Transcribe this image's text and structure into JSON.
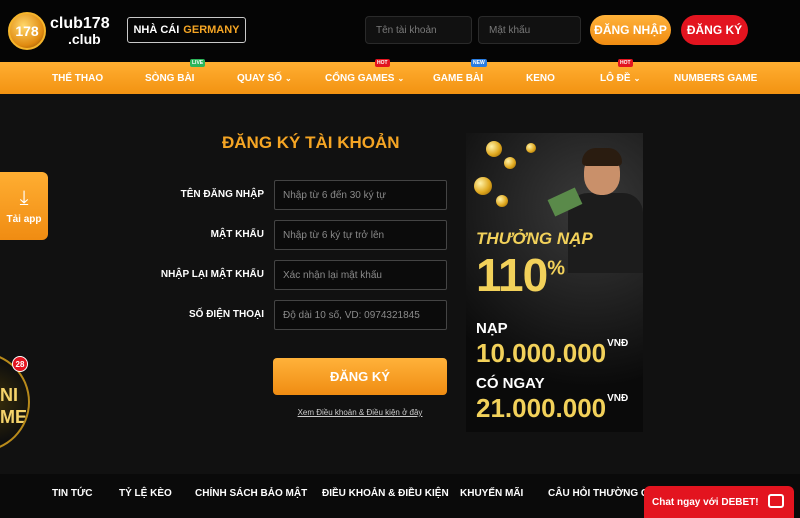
{
  "header": {
    "logo": {
      "line1": "club178",
      "line2": ".club",
      "mark": "178"
    },
    "brand_prefix": "NHÀ CÁI",
    "brand_name": "GERMANY",
    "username_placeholder": "Tên tài khoản",
    "password_placeholder": "Mật khẩu",
    "login_label": "ĐĂNG NHẬP",
    "register_label": "ĐĂNG KÝ"
  },
  "nav": {
    "items": [
      {
        "label": "THỂ THAO"
      },
      {
        "label": "SÒNG BÀI",
        "tag": "LIVE"
      },
      {
        "label": "QUAY SỐ",
        "chevron": "⌄"
      },
      {
        "label": "CỔNG GAMES",
        "tag": "HOT",
        "chevron": "⌄"
      },
      {
        "label": "GAME BÀI",
        "tag": "NEW"
      },
      {
        "label": "KENO"
      },
      {
        "label": "LÔ ĐỀ",
        "tag": "HOT",
        "chevron": "⌄"
      },
      {
        "label": "NUMBERS GAME"
      }
    ]
  },
  "side": {
    "app_label": "Tải app",
    "app_icon": "download-icon",
    "mini_game_text": "NI\nME",
    "mini_game_badge": "28"
  },
  "form": {
    "title": "ĐĂNG KÝ TÀI KHOẢN",
    "fields": [
      {
        "label": "TÊN ĐĂNG NHẬP",
        "placeholder": "Nhập từ 6 đến 30 ký tự"
      },
      {
        "label": "MẬT KHẨU",
        "placeholder": "Nhập từ 6 ký tự trở lên"
      },
      {
        "label": "NHẬP LẠI MẬT KHẨU",
        "placeholder": "Xác nhận lại mật khẩu"
      },
      {
        "label": "SỐ ĐIỆN THOẠI",
        "placeholder": "Độ dài 10 số, VD: 0974321845"
      }
    ],
    "submit_label": "ĐĂNG KÝ",
    "terms_label": "Xem Điều khoản & Điều kiện ở đây"
  },
  "promo": {
    "line1": "THƯỞNG NẠP",
    "percent": "110",
    "percent_sign": "%",
    "deposit_label": "NẠP",
    "deposit_amount": "10.000.000",
    "bonus_label": "CÓ NGAY",
    "bonus_amount": "21.000.000",
    "currency": "VNĐ"
  },
  "footer": {
    "items": [
      "TIN TỨC",
      "TỶ LỆ KÈO",
      "CHÍNH SÁCH BẢO MẬT",
      "ĐIỀU KHOẢN & ĐIỀU KIỆN",
      "KHUYẾN MÃI",
      "CÂU HỎI THƯỜNG GẶP"
    ]
  },
  "chat": {
    "label": "Chat ngay với DEBET!",
    "icon": "chat-icon"
  },
  "colors": {
    "accent": "#f5a524",
    "red": "#e3141f",
    "background": "#111111"
  }
}
